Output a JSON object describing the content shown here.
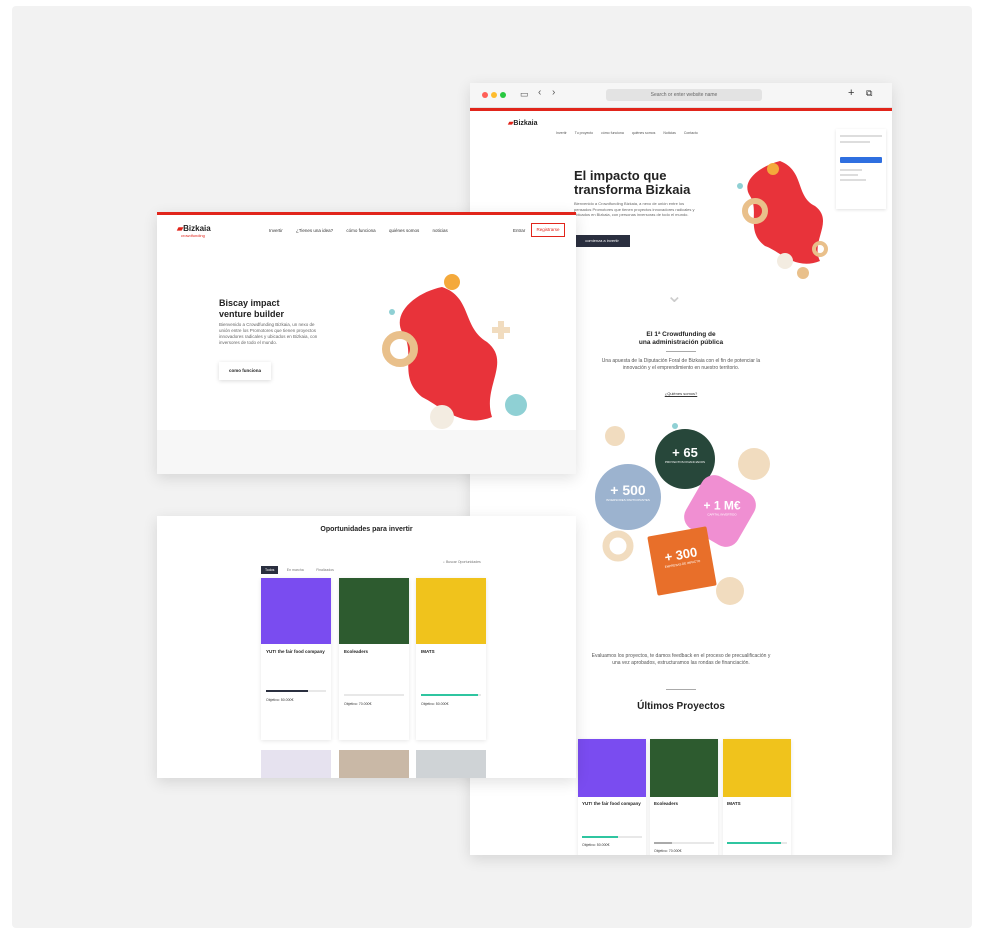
{
  "browser": {
    "address_placeholder": "Search or enter website name",
    "brand": "Bizkaia",
    "hero_title_1": "El impacto que",
    "hero_title_2": "transforma Bizkaia",
    "hero_text": "Bienvenido a Crowdfunding Bizkaia, a nexo de unión entre los pensados Promotores que tienen proyectos innovadores radicales y ubicados en Bizkaia, con personas inversoras de todo el mundo.",
    "hero_button": "comienza a invertir",
    "section_title_1": "El 1ª Crowdfunding de",
    "section_title_2": "una administración pública",
    "section_text": "Una apuesta de la Diputación Foral de Bizkaia con el fin de potenciar la innovación y el emprendimiento en nuestro territorio.",
    "section_link": "¿Quiénes somos?",
    "stats": [
      {
        "value": "+ 500",
        "label": "INVERSORES PARTICIPANTES",
        "color": "#9cb3cf"
      },
      {
        "value": "+ 65",
        "label": "PROYECTOS FINANCIADOS",
        "color": "#27473a"
      },
      {
        "value": "+ 1 M€",
        "label": "CAPITAL INVERTIDO",
        "color": "#f08fd2"
      },
      {
        "value": "+ 300",
        "label": "EMPRESAS DE IMPACTO",
        "color": "#e86f2a"
      }
    ],
    "evaluation_text": "Evaluamos los proyectos, te damos feedback en el proceso de precualificación y una vez aprobados, estructuramos las rondas de financiación.",
    "latest_title": "Últimos Proyectos",
    "cards": [
      {
        "title": "YUT! the fair food company",
        "goal": "Objetivo: 50.000€",
        "img": "#7a4cf0",
        "fill": 0.6,
        "fillcolor": "#2fc5a0"
      },
      {
        "title": "Ecoleaders",
        "goal": "Objetivo: 70.000€",
        "img": "#2d5b2f",
        "fill": 0.3,
        "fillcolor": "#aaaaaa"
      },
      {
        "title": "IMATS",
        "goal": "",
        "img": "#f0c31c",
        "fill": 0.9,
        "fillcolor": "#2fc5a0"
      }
    ]
  },
  "landing": {
    "brand": "Bizkaia",
    "brand_sub": "crowdfunding",
    "nav": [
      "Invertir",
      "¿Tienes una idea?",
      "cómo funciona",
      "quiénes somos",
      "noticias"
    ],
    "enter": "Entrar",
    "register": "Registrarse",
    "title_1": "Biscay impact",
    "title_2": "venture builder",
    "text": "Bienvenido a Crowdfunding Bizkaia, un nexo de unión entre los Promotores que tienen proyectos innovadores radicales y ubicados en Bizkaia, con inversores de todo el mundo.",
    "button": "como funciona"
  },
  "opps": {
    "title": "Oportunidades para invertir",
    "tabs": [
      "Todos",
      "En marcha",
      "Finalizados"
    ],
    "filter": "Buscar Oportunidades",
    "cards": [
      {
        "title": "YUT! the fair food company",
        "goal": "Objetivo: 50.000€",
        "img": "#7a4cf0",
        "fill": 0.7,
        "fillcolor": "#2a2f3f"
      },
      {
        "title": "Ecoleaders",
        "goal": "Objetivo: 70.000€",
        "img": "#2d5b2f",
        "fill": 0.0,
        "fillcolor": "#aaaaaa"
      },
      {
        "title": "IMATS",
        "goal": "Objetivo: 50.000€",
        "img": "#f0c31c",
        "fill": 0.95,
        "fillcolor": "#2fc5a0"
      }
    ]
  }
}
